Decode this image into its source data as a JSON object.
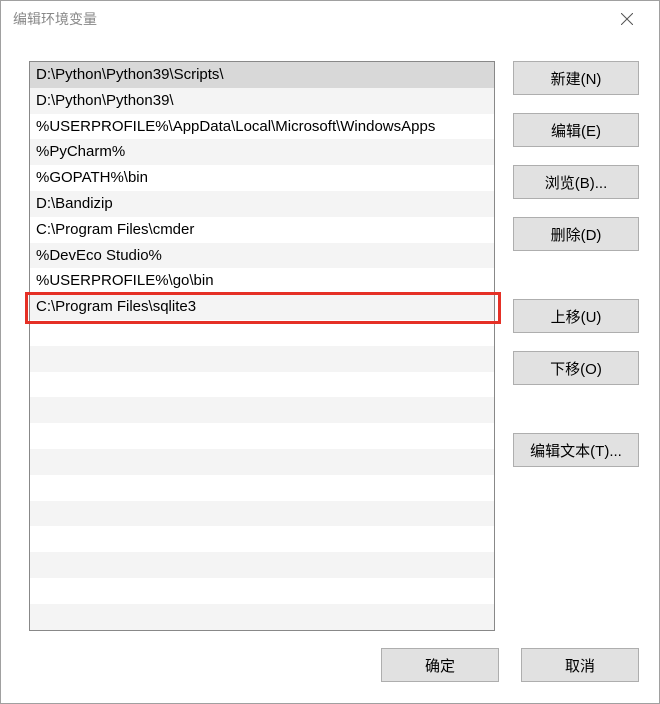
{
  "window": {
    "title": "编辑环境变量"
  },
  "list": {
    "items": [
      "D:\\Python\\Python39\\Scripts\\",
      "D:\\Python\\Python39\\",
      "%USERPROFILE%\\AppData\\Local\\Microsoft\\WindowsApps",
      "%PyCharm%",
      "%GOPATH%\\bin",
      "D:\\Bandizip",
      "C:\\Program Files\\cmder",
      "%DevEco Studio%",
      "%USERPROFILE%\\go\\bin",
      "C:\\Program Files\\sqlite3"
    ],
    "selected_index": 0,
    "highlighted_index": 9
  },
  "buttons": {
    "new": "新建(N)",
    "edit": "编辑(E)",
    "browse": "浏览(B)...",
    "delete": "删除(D)",
    "move_up": "上移(U)",
    "move_down": "下移(O)",
    "edit_text": "编辑文本(T)...",
    "ok": "确定",
    "cancel": "取消"
  },
  "layout": {
    "total_rows": 22,
    "row_height": 25.8
  }
}
